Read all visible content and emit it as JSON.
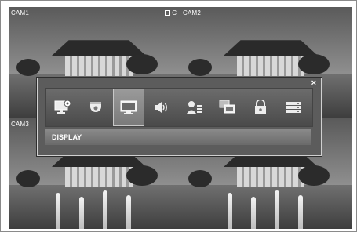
{
  "cameras": [
    {
      "label": "CAM1",
      "rec_indicator": "C"
    },
    {
      "label": "CAM2"
    },
    {
      "label": "CAM3"
    },
    {
      "label": ""
    }
  ],
  "menu": {
    "close_glyph": "×",
    "items": [
      {
        "icon": "monitor-settings-icon"
      },
      {
        "icon": "camera-icon"
      },
      {
        "icon": "display-icon",
        "selected": true
      },
      {
        "icon": "speaker-icon"
      },
      {
        "icon": "user-icon"
      },
      {
        "icon": "multi-screen-icon"
      },
      {
        "icon": "lock-icon"
      },
      {
        "icon": "storage-icon"
      }
    ],
    "status_label": "DISPLAY"
  }
}
